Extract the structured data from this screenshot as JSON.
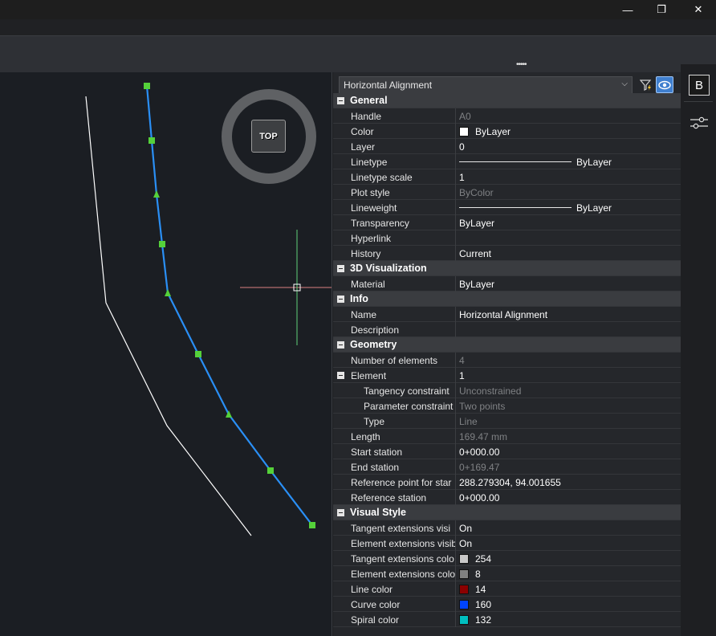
{
  "window": {
    "minimize_glyph": "—",
    "maximize_glyph": "❐",
    "close_glyph": "✕"
  },
  "viewcube": {
    "top_label": "TOP"
  },
  "panel": {
    "selected_type": "Horizontal Alignment",
    "icons": [
      "quick-select-icon",
      "toggle-pickadd-icon"
    ]
  },
  "sidebar": {
    "properties_label": "B"
  },
  "groups": [
    {
      "label": "General",
      "rows": [
        {
          "name": "Handle",
          "value": "A0",
          "ro": true
        },
        {
          "name": "Color",
          "value": "ByLayer",
          "swatch": "#ffffff"
        },
        {
          "name": "Layer",
          "value": "0"
        },
        {
          "name": "Linetype",
          "value": "ByLayer",
          "line": true
        },
        {
          "name": "Linetype scale",
          "value": "1"
        },
        {
          "name": "Plot style",
          "value": "ByColor",
          "ro": true
        },
        {
          "name": "Lineweight",
          "value": "ByLayer",
          "line": true
        },
        {
          "name": "Transparency",
          "value": "ByLayer"
        },
        {
          "name": "Hyperlink",
          "value": ""
        },
        {
          "name": "History",
          "value": "Current"
        }
      ]
    },
    {
      "label": "3D Visualization",
      "rows": [
        {
          "name": "Material",
          "value": "ByLayer"
        }
      ]
    },
    {
      "label": "Info",
      "rows": [
        {
          "name": "Name",
          "value": "Horizontal Alignment"
        },
        {
          "name": "Description",
          "value": ""
        }
      ]
    },
    {
      "label": "Geometry",
      "rows": [
        {
          "name": "Number of elements",
          "value": "4",
          "ro": true
        },
        {
          "name": "Element",
          "value": "1",
          "expander": true
        },
        {
          "name": "Tangency constraint",
          "value": "Unconstrained",
          "ro": true,
          "indent": true
        },
        {
          "name": "Parameter constraint",
          "value": "Two points",
          "ro": true,
          "indent": true
        },
        {
          "name": "Type",
          "value": "Line",
          "ro": true,
          "indent": true
        },
        {
          "name": "Length",
          "value": "169.47 mm",
          "ro": true
        },
        {
          "name": "Start station",
          "value": "0+000.00"
        },
        {
          "name": "End station",
          "value": "0+169.47",
          "ro": true
        },
        {
          "name": "Reference point for star",
          "value": "288.279304, 94.001655"
        },
        {
          "name": "Reference station",
          "value": "0+000.00"
        }
      ]
    },
    {
      "label": "Visual Style",
      "rows": [
        {
          "name": "Tangent extensions visi",
          "value": "On"
        },
        {
          "name": "Element extensions visib",
          "value": "On"
        },
        {
          "name": "Tangent extensions colo",
          "value": "254",
          "swatch": "#c8c8c8"
        },
        {
          "name": "Element extensions colo",
          "value": "8",
          "swatch": "#808080"
        },
        {
          "name": "Line color",
          "value": "14",
          "swatch": "#8b0000"
        },
        {
          "name": "Curve color",
          "value": "160",
          "swatch": "#0044ff"
        },
        {
          "name": "Spiral color",
          "value": "132",
          "swatch": "#00bfbf"
        }
      ]
    }
  ]
}
